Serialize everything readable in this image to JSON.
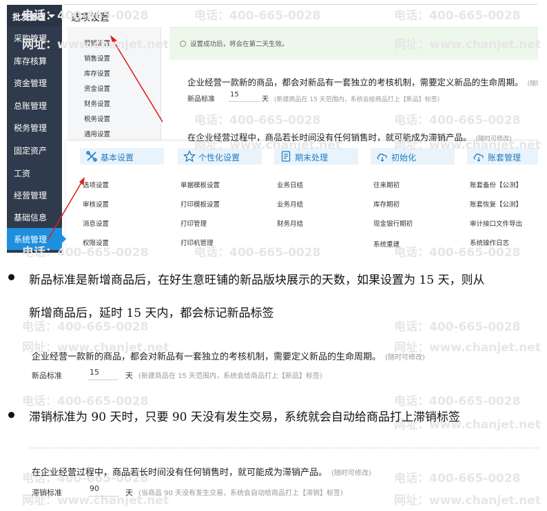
{
  "sidebar": {
    "header": "批发管理",
    "items": [
      "采购管理",
      "库存核算",
      "资金管理",
      "总账管理",
      "税务管理",
      "固定资产",
      "工资",
      "经营管理",
      "基础信息",
      "系统管理"
    ],
    "active_index": 9
  },
  "main": {
    "title": "选项设置"
  },
  "subnav": {
    "items": [
      "营销设置",
      "销售设置",
      "库存设置",
      "资金设置",
      "财务设置",
      "税务设置",
      "通用设置"
    ]
  },
  "tip": {
    "text": "设置成功后，将会在第二天生效。"
  },
  "panel_new": {
    "text": "企业经营一款新的商品，都会对新品有一套独立的考核机制，需要定义新品的生命周期。",
    "hint": "(随时可修",
    "label": "新品标准",
    "value": "15",
    "unit": "天",
    "note": "(新建商品在 15 天范围内，系统会给商品打上【新品】标签)"
  },
  "panel_slow": {
    "text": "在企业经营过程中，商品若长时间没有任何销售时，就可能成为滞销产品。",
    "hint": "(随时可修改)"
  },
  "mega_menu": [
    {
      "title": "基本设置",
      "icon": "wrench-cross-icon",
      "items": [
        "选项设置",
        "审核设置",
        "消息设置",
        "权限设置"
      ]
    },
    {
      "title": "个性化设置",
      "icon": "star-icon",
      "items": [
        "单据模板设置",
        "打印模板设置",
        "打印管理",
        "打印机管理"
      ]
    },
    {
      "title": "期末处理",
      "icon": "document-icon",
      "items": [
        "业务日结",
        "业务月结",
        "财务月结"
      ]
    },
    {
      "title": "初始化",
      "icon": "cloud-icon",
      "items": [
        "往来期初",
        "库存期初",
        "现金银行期初",
        "系统重建"
      ]
    },
    {
      "title": "账套管理",
      "icon": "cloud-icon",
      "items": [
        "账套备份【公测】",
        "账套恢复【公测】",
        "审计接口文件导出",
        "系统操作日志"
      ]
    }
  ],
  "bullets": {
    "b1_line1": "新品标准是新增商品后，在好生意旺铺的新品版块展示的天数，如果设置为 15 天，则从",
    "b1_line2": "新增商品后，延时 15 天内，都会标记新品标签",
    "b2": "滞销标准为 90 天时，只要 90 天没有发生交易，系统就会自动给商品打上滞销标签"
  },
  "demo_new": {
    "text": "企业经营一款新的商品，都会对新品有一套独立的考核机制，需要定义新品的生命周期。",
    "hint": "(随时可修改)",
    "label": "新品标准",
    "value": "15",
    "unit": "天",
    "note": "(新建商品在 15 天范围内，系统会给商品打上【新品】标签)"
  },
  "demo_slow": {
    "text": "在企业经营过程中，商品若长时间没有任何销售时，就可能成为滞销产品。",
    "hint": "(随时可修改)",
    "label": "滞销标准",
    "value": "90",
    "unit": "天",
    "note": "(当商品 90 天没有发生交易，系统会自动给商品打上【滞销】标签)"
  },
  "watermark": {
    "phone": "电话：400-665-0028",
    "web": "网址：www.chanjet.net"
  },
  "colors": {
    "sidebar_bg": "#2f3a4c",
    "active_blue": "#1e8fdc",
    "arrow_red": "#e02020",
    "tip_bg": "#eef7ec"
  }
}
